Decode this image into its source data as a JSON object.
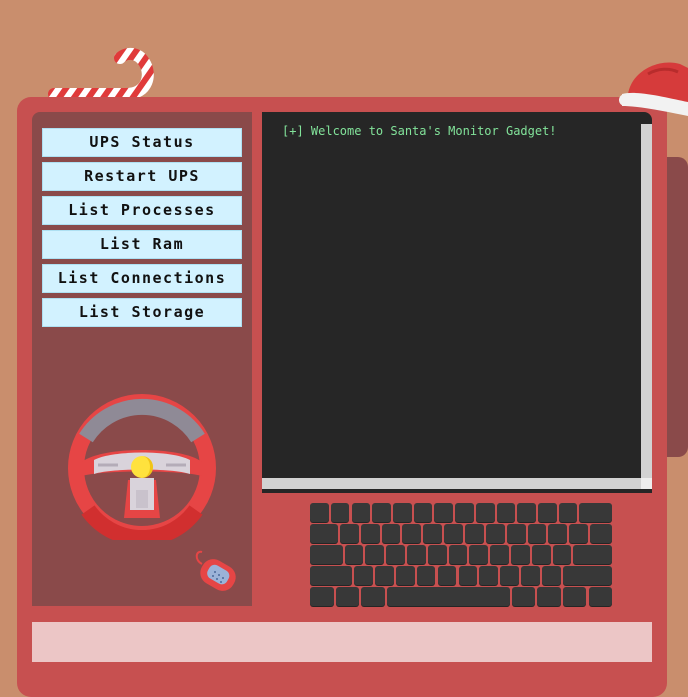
{
  "menu": {
    "items": [
      {
        "label": "UPS Status"
      },
      {
        "label": "Restart UPS"
      },
      {
        "label": "List Processes"
      },
      {
        "label": "List Ram"
      },
      {
        "label": "List Connections"
      },
      {
        "label": "List Storage"
      }
    ]
  },
  "terminal": {
    "lines": [
      "[+] Welcome to Santa's Monitor Gadget!"
    ]
  },
  "decorations": {
    "icons": [
      "candy-cane-icon",
      "santa-hat-icon",
      "steering-wheel-icon",
      "car-key-icon"
    ]
  },
  "colors": {
    "background": "#c98e6d",
    "device": "#c75050",
    "panel": "#8a4a4a",
    "menu_button": "#d2f2ff",
    "screen": "#262626",
    "terminal_text": "#82e39a",
    "bottom_panel": "#ecc6c6"
  }
}
